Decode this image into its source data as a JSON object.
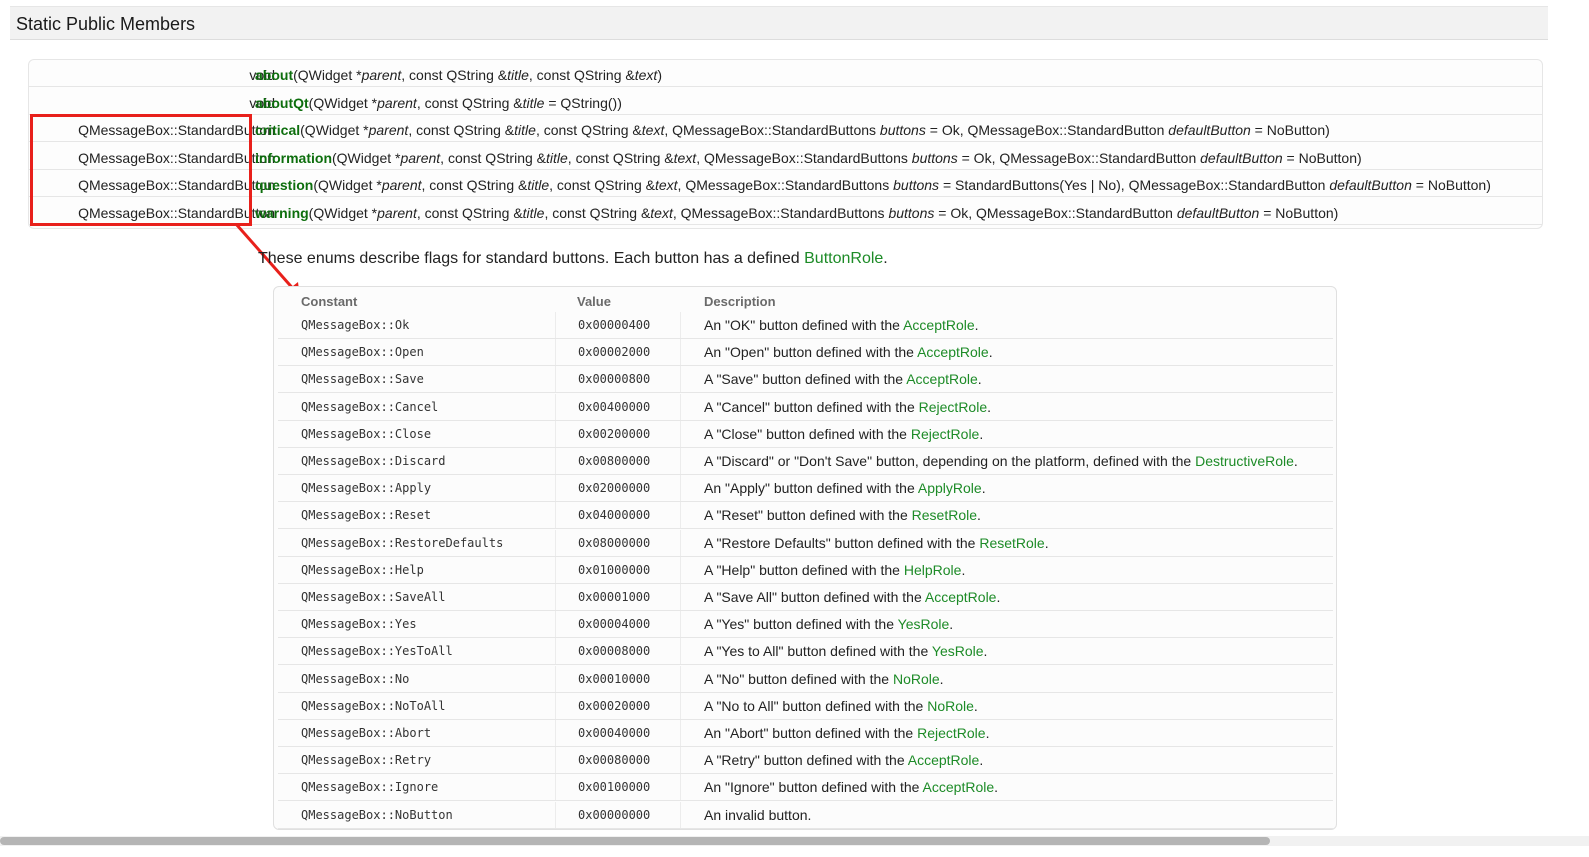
{
  "section": {
    "title": "Static Public Members"
  },
  "members": [
    {
      "ret": "void",
      "name": "about",
      "args_html": "(QWidget *<i>parent</i>, const QString &amp;<i>title</i>, const QString &amp;<i>text</i>)"
    },
    {
      "ret": "void",
      "name": "aboutQt",
      "args_html": "(QWidget *<i>parent</i>, const QString &amp;<i>title</i> = QString())"
    },
    {
      "ret": "QMessageBox::StandardButton",
      "name": "critical",
      "args_html": "(QWidget *<i>parent</i>, const QString &amp;<i>title</i>, const QString &amp;<i>text</i>, QMessageBox::StandardButtons <i>buttons</i> = Ok, QMessageBox::StandardButton <i>defaultButton</i> = NoButton)"
    },
    {
      "ret": "QMessageBox::StandardButton",
      "name": "information",
      "args_html": "(QWidget *<i>parent</i>, const QString &amp;<i>title</i>, const QString &amp;<i>text</i>, QMessageBox::StandardButtons <i>buttons</i> = Ok, QMessageBox::StandardButton <i>defaultButton</i> = NoButton)"
    },
    {
      "ret": "QMessageBox::StandardButton",
      "name": "question",
      "args_html": "(QWidget *<i>parent</i>, const QString &amp;<i>title</i>, const QString &amp;<i>text</i>, QMessageBox::StandardButtons <i>buttons</i> = StandardButtons(Yes | No), QMessageBox::StandardButton <i>defaultButton</i> = NoButton)"
    },
    {
      "ret": "QMessageBox::StandardButton",
      "name": "warning",
      "args_html": "(QWidget *<i>parent</i>, const QString &amp;<i>title</i>, const QString &amp;<i>text</i>, QMessageBox::StandardButtons <i>buttons</i> = Ok, QMessageBox::StandardButton <i>defaultButton</i> = NoButton)"
    }
  ],
  "intro": {
    "text": "These enums describe flags for standard buttons. Each button has a defined ",
    "link": "ButtonRole",
    "end": "."
  },
  "table": {
    "headers": {
      "constant": "Constant",
      "value": "Value",
      "description": "Description"
    },
    "rows": [
      {
        "constant": "QMessageBox::Ok",
        "value": "0x00000400",
        "pre": "An \"OK\" button defined with the ",
        "role": "AcceptRole",
        "post": "."
      },
      {
        "constant": "QMessageBox::Open",
        "value": "0x00002000",
        "pre": "An \"Open\" button defined with the ",
        "role": "AcceptRole",
        "post": "."
      },
      {
        "constant": "QMessageBox::Save",
        "value": "0x00000800",
        "pre": "A \"Save\" button defined with the ",
        "role": "AcceptRole",
        "post": "."
      },
      {
        "constant": "QMessageBox::Cancel",
        "value": "0x00400000",
        "pre": "A \"Cancel\" button defined with the ",
        "role": "RejectRole",
        "post": "."
      },
      {
        "constant": "QMessageBox::Close",
        "value": "0x00200000",
        "pre": "A \"Close\" button defined with the ",
        "role": "RejectRole",
        "post": "."
      },
      {
        "constant": "QMessageBox::Discard",
        "value": "0x00800000",
        "pre": "A \"Discard\" or \"Don't Save\" button, depending on the platform, defined with the ",
        "role": "DestructiveRole",
        "post": "."
      },
      {
        "constant": "QMessageBox::Apply",
        "value": "0x02000000",
        "pre": "An \"Apply\" button defined with the ",
        "role": "ApplyRole",
        "post": "."
      },
      {
        "constant": "QMessageBox::Reset",
        "value": "0x04000000",
        "pre": "A \"Reset\" button defined with the ",
        "role": "ResetRole",
        "post": "."
      },
      {
        "constant": "QMessageBox::RestoreDefaults",
        "value": "0x08000000",
        "pre": "A \"Restore Defaults\" button defined with the ",
        "role": "ResetRole",
        "post": "."
      },
      {
        "constant": "QMessageBox::Help",
        "value": "0x01000000",
        "pre": "A \"Help\" button defined with the ",
        "role": "HelpRole",
        "post": "."
      },
      {
        "constant": "QMessageBox::SaveAll",
        "value": "0x00001000",
        "pre": "A \"Save All\" button defined with the ",
        "role": "AcceptRole",
        "post": "."
      },
      {
        "constant": "QMessageBox::Yes",
        "value": "0x00004000",
        "pre": "A \"Yes\" button defined with the ",
        "role": "YesRole",
        "post": "."
      },
      {
        "constant": "QMessageBox::YesToAll",
        "value": "0x00008000",
        "pre": "A \"Yes to All\" button defined with the ",
        "role": "YesRole",
        "post": "."
      },
      {
        "constant": "QMessageBox::No",
        "value": "0x00010000",
        "pre": "A \"No\" button defined with the ",
        "role": "NoRole",
        "post": "."
      },
      {
        "constant": "QMessageBox::NoToAll",
        "value": "0x00020000",
        "pre": "A \"No to All\" button defined with the ",
        "role": "NoRole",
        "post": "."
      },
      {
        "constant": "QMessageBox::Abort",
        "value": "0x00040000",
        "pre": "An \"Abort\" button defined with the ",
        "role": "RejectRole",
        "post": "."
      },
      {
        "constant": "QMessageBox::Retry",
        "value": "0x00080000",
        "pre": "A \"Retry\" button defined with the ",
        "role": "AcceptRole",
        "post": "."
      },
      {
        "constant": "QMessageBox::Ignore",
        "value": "0x00100000",
        "pre": "An \"Ignore\" button defined with the ",
        "role": "AcceptRole",
        "post": "."
      },
      {
        "constant": "QMessageBox::NoButton",
        "value": "0x00000000",
        "pre": "An invalid button.",
        "role": "",
        "post": ""
      }
    ]
  },
  "colors": {
    "link": "#1d8b27",
    "function_name": "#0d6e0d",
    "annotation": "#e8201b"
  }
}
